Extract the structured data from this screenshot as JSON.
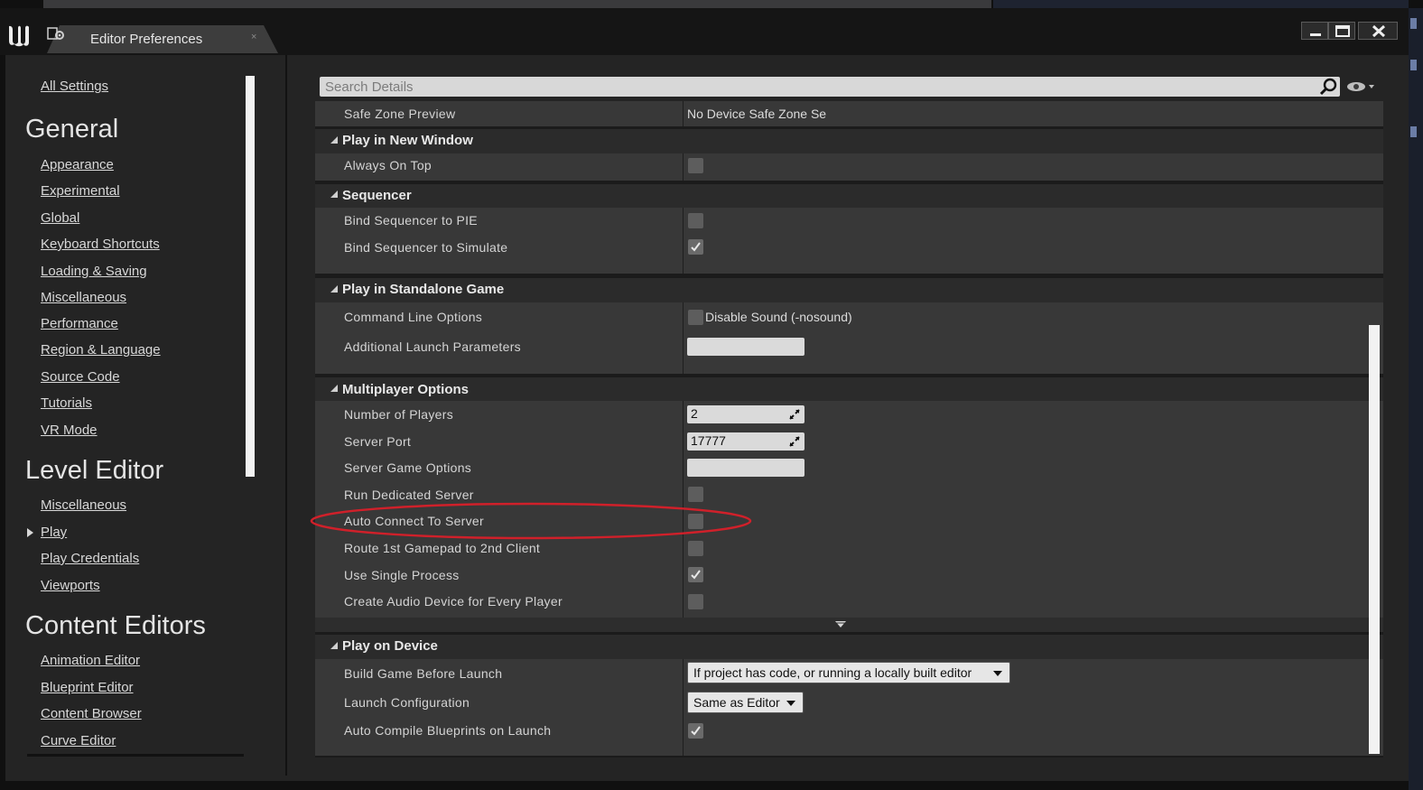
{
  "window": {
    "tab_title": "Editor Preferences",
    "tab_close": "×"
  },
  "sidebar": {
    "all_settings": "All Settings",
    "groups": [
      {
        "heading": "General",
        "items": [
          "Appearance",
          "Experimental",
          "Global",
          "Keyboard Shortcuts",
          "Loading & Saving",
          "Miscellaneous",
          "Performance",
          "Region & Language",
          "Source Code",
          "Tutorials",
          "VR Mode"
        ]
      },
      {
        "heading": "Level Editor",
        "items": [
          "Miscellaneous",
          "Play",
          "Play Credentials",
          "Viewports"
        ]
      },
      {
        "heading": "Content Editors",
        "items": [
          "Animation Editor",
          "Blueprint Editor",
          "Content Browser",
          "Curve Editor"
        ]
      }
    ],
    "selected_item": "Play"
  },
  "search": {
    "placeholder": "Search Details"
  },
  "details": {
    "safe_zone": {
      "label": "Safe Zone Preview",
      "value": "No Device Safe Zone Se"
    },
    "play_in_new_window": {
      "title": "Play in New Window",
      "always_on_top": {
        "label": "Always On Top",
        "checked": false
      }
    },
    "sequencer": {
      "title": "Sequencer",
      "bind_pie": {
        "label": "Bind Sequencer to PIE",
        "checked": false
      },
      "bind_simulate": {
        "label": "Bind Sequencer to Simulate",
        "checked": true
      }
    },
    "standalone": {
      "title": "Play in Standalone Game",
      "cmd_options": {
        "label": "Command Line Options",
        "option": "Disable Sound (-nosound)",
        "checked": false
      },
      "launch_params": {
        "label": "Additional Launch Parameters",
        "value": ""
      }
    },
    "multiplayer": {
      "title": "Multiplayer Options",
      "num_players": {
        "label": "Number of Players",
        "value": "2"
      },
      "server_port": {
        "label": "Server Port",
        "value": "17777"
      },
      "server_game_options": {
        "label": "Server Game Options",
        "value": ""
      },
      "dedicated_server": {
        "label": "Run Dedicated Server",
        "checked": false
      },
      "auto_connect": {
        "label": "Auto Connect To Server",
        "checked": false
      },
      "route_gamepad": {
        "label": "Route 1st Gamepad to 2nd Client",
        "checked": false
      },
      "single_process": {
        "label": "Use Single Process",
        "checked": true
      },
      "audio_device": {
        "label": "Create Audio Device for Every Player",
        "checked": false
      }
    },
    "play_on_device": {
      "title": "Play on Device",
      "build_before_launch": {
        "label": "Build Game Before Launch",
        "value": "If project has code, or running a locally built editor"
      },
      "launch_config": {
        "label": "Launch Configuration",
        "value": "Same as Editor"
      },
      "auto_compile": {
        "label": "Auto Compile Blueprints on Launch",
        "checked": true
      }
    }
  },
  "colors": {
    "panel_bg": "#242424",
    "row_bg": "#383838",
    "category_bg": "#2b2b2b",
    "highlight_ellipse": "#d0202a"
  }
}
